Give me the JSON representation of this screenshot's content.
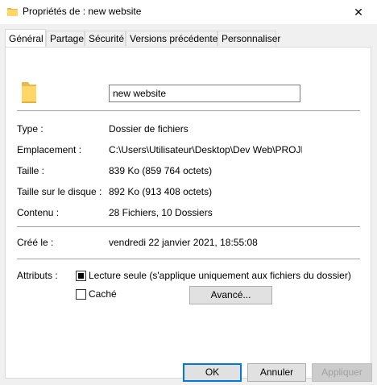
{
  "window": {
    "title": "Propriétés de : new website",
    "close_glyph": "✕"
  },
  "tabs": [
    {
      "label": "Général",
      "active": true
    },
    {
      "label": "Partage",
      "active": false
    },
    {
      "label": "Sécurité",
      "active": false
    },
    {
      "label": "Versions précédentes",
      "active": false
    },
    {
      "label": "Personnaliser",
      "active": false
    }
  ],
  "folder_name": "new website",
  "properties": {
    "type": {
      "label": "Type :",
      "value": "Dossier de fichiers"
    },
    "location": {
      "label": "Emplacement :",
      "value": "C:\\Users\\Utilisateur\\Desktop\\Dev Web\\PROJETS"
    },
    "size": {
      "label": "Taille :",
      "value": "839 Ko (859 764 octets)"
    },
    "size_on_disk": {
      "label": "Taille sur le disque :",
      "value": "892 Ko (913 408 octets)"
    },
    "contents": {
      "label": "Contenu :",
      "value": "28 Fichiers, 10 Dossiers"
    },
    "created": {
      "label": "Créé le :",
      "value": "vendredi 22 janvier 2021, 18:55:08"
    }
  },
  "attributes": {
    "label": "Attributs :",
    "read_only": {
      "label": "Lecture seule (s'applique uniquement aux fichiers du dossier)",
      "checked": true
    },
    "hidden": {
      "label": "Caché",
      "checked": false
    },
    "advanced_button": "Avancé..."
  },
  "buttons": {
    "ok": "OK",
    "cancel": "Annuler",
    "apply": "Appliquer"
  },
  "colors": {
    "folder": "#ffd766",
    "folder_dark": "#e8b94a",
    "focus_blue": "#0078d7"
  }
}
